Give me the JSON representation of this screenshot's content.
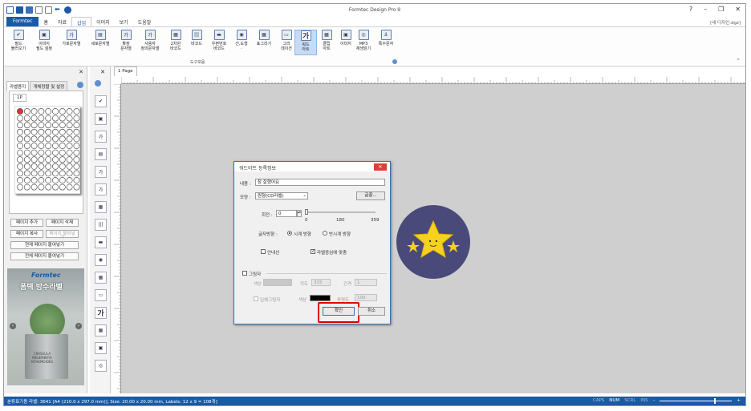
{
  "window": {
    "title": "Formtec Design Pro 9",
    "doc_label": "[새 디자인.dgz]",
    "controls": [
      "?",
      "–",
      "❐",
      "✕"
    ]
  },
  "tabs": [
    {
      "label": "Formtec"
    },
    {
      "label": "홈"
    },
    {
      "label": "자료"
    },
    {
      "label": "삽입"
    },
    {
      "label": "이미지"
    },
    {
      "label": "보기"
    },
    {
      "label": "도움말"
    }
  ],
  "ribbon": {
    "items": [
      {
        "label": "필드\n불러오기",
        "icon": "✔"
      },
      {
        "label": "이미지\n필드 설정",
        "icon": "▣"
      },
      {
        "label": "가로문자열",
        "icon": "가"
      },
      {
        "label": "세로문자열",
        "icon": "▤"
      },
      {
        "label": "확장\n문자열",
        "icon": "가"
      },
      {
        "label": "사용자\n정의문자열",
        "icon": "가"
      },
      {
        "label": "2차원\n바코드",
        "icon": "▦"
      },
      {
        "label": "바코드",
        "icon": "|||"
      },
      {
        "label": "우편번호\n바코드",
        "icon": "▬"
      },
      {
        "label": "선,도형\n·",
        "icon": "◉"
      },
      {
        "label": "표그리기",
        "icon": "▦"
      },
      {
        "label": "그라\n데이션",
        "icon": "▭"
      },
      {
        "label": "워드\n아트",
        "icon": "가"
      },
      {
        "label": "클립\n아트",
        "icon": "▦"
      },
      {
        "label": "이미지",
        "icon": "▣"
      },
      {
        "label": "MP3\n재생읽기",
        "icon": "◎"
      },
      {
        "label": "특수문자",
        "icon": "á"
      }
    ],
    "group_label": "도구모음"
  },
  "left_panel": {
    "tabs": [
      "라벨용지",
      "개체정렬 및 설정"
    ],
    "sheet_tab": "1P",
    "buttons": [
      "페이지 추가",
      "페이지 삭제",
      "페이지 복사",
      "페이지 붙여넣기",
      "현재 페이지 붙여넣기",
      "전체 페이지 붙여넣기"
    ],
    "ad": {
      "brand": "Formtec",
      "title": "폼텍 방수라벨",
      "pot_text": "CRASSULA\nMESEMBRYA\nNTHEMOIDES"
    }
  },
  "doc_tab": "1 Page",
  "dialog": {
    "title": "워드아트 등록정보",
    "content_label": "내용 :",
    "content_value": "참 잘했어요",
    "shape_label": "모양 :",
    "shape_value": "원형(CD라벨)",
    "font_button": "글꼴...",
    "rotation_label": "회전 :",
    "rotation_value": "0",
    "slider_ticks": [
      "0",
      "180",
      "359"
    ],
    "direction_label": "글자방향 :",
    "dir_clockwise": "시계 방향",
    "dir_counter": "반시계 방향",
    "underline": "안내선",
    "fit_label": "라벨중심에 맞춤",
    "shadow_label": "그림자",
    "color_label": "색상",
    "angle_label": "각도",
    "angle_value": "315",
    "gap_label": "간격",
    "gap_value": "1",
    "solid_shadow": "입체그림자",
    "color2_label": "색상",
    "opacity_label": "투명도",
    "opacity_value": "100",
    "ok": "확인",
    "cancel": "취소"
  },
  "colors": {
    "accent": "#1b5aa5",
    "badge_bg": "#4a4a7a",
    "star": "#f6d21f",
    "highlight": "#e00000"
  },
  "status": {
    "left": "분류표기용 라벨: 3641 [A4 (210.0 x 297.0 mm)], Size: 20.00 x 20.00 mm, Labels: 12 x 9 = 108개]",
    "indicators": [
      "CAPS",
      "NUM",
      "SCRL",
      "INS"
    ],
    "zoom_minus": "–",
    "zoom_plus": "+"
  }
}
